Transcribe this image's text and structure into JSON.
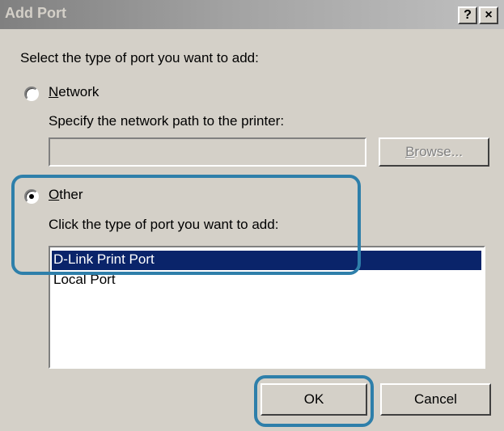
{
  "dialog": {
    "title": "Add Port",
    "help_button": "?",
    "close_button": "×"
  },
  "prompt": "Select the type of port you want to add:",
  "network_option": {
    "label_accel": "N",
    "label_rest": "etwork",
    "selected": false,
    "path_prompt": "Specify the network path to the printer:",
    "path_value": "",
    "browse_label_accel": "B",
    "browse_label_rest": "rowse..."
  },
  "other_option": {
    "label_accel": "O",
    "label_rest": "ther",
    "selected": true,
    "list_prompt": "Click the type of port you want to add:",
    "port_types": [
      "D-Link Print Port",
      "Local Port"
    ],
    "selected_port": "D-Link Print Port"
  },
  "buttons": {
    "ok": "OK",
    "cancel": "Cancel"
  },
  "colors": {
    "highlight_outline": "#2e7faa",
    "selection": "#0a246a"
  }
}
